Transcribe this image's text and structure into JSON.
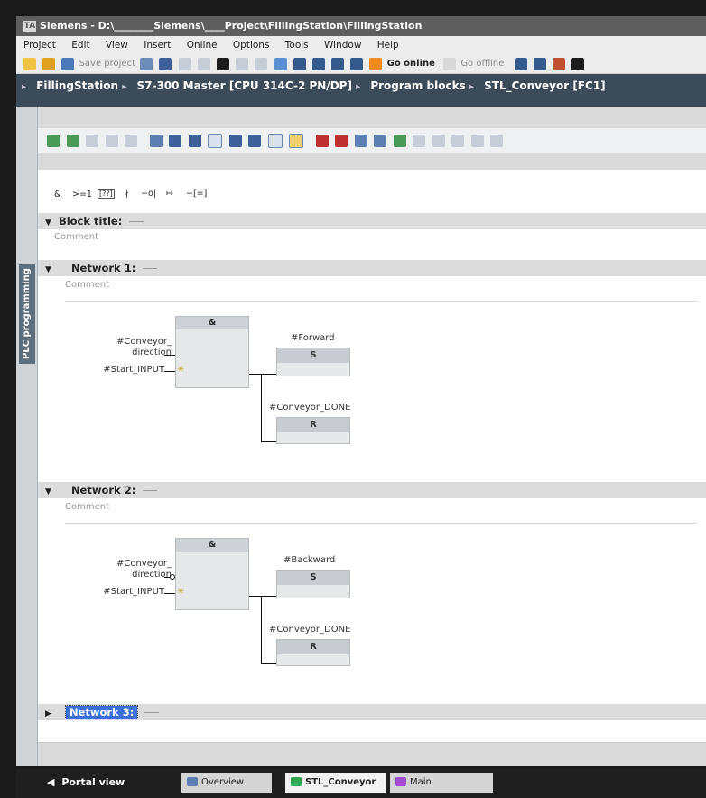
{
  "window": {
    "title": "Siemens - D:\\________Siemens\\____Project\\FillingStation\\FillingStation"
  },
  "menu": [
    "Project",
    "Edit",
    "View",
    "Insert",
    "Online",
    "Options",
    "Tools",
    "Window",
    "Help"
  ],
  "toolbar": {
    "save_label": "Save project",
    "go_online_label": "Go online",
    "go_offline_label": "Go offline"
  },
  "breadcrumb": [
    "FillingStation",
    "S7-300 Master [CPU 314C-2 PN/DP]",
    "Program blocks",
    "STL_Conveyor [FC1]"
  ],
  "side_panel": {
    "label": "PLC programming"
  },
  "lad_palette": [
    "&",
    ">=1",
    "[??]",
    "∤",
    "−o|",
    "↦",
    "−[=]"
  ],
  "block": {
    "title_label": "Block title:",
    "comment_placeholder": "Comment"
  },
  "networks": [
    {
      "label": "Network 1:",
      "comment_placeholder": "Comment",
      "and_label": "&",
      "inputs": [
        {
          "name_line1": "#Conveyor_",
          "name_line2": "direction",
          "negated": false
        },
        {
          "name_line1": "#Start_INPUT",
          "negated": false
        }
      ],
      "coils": [
        {
          "operand": "#Forward",
          "type": "S"
        },
        {
          "operand": "#Conveyor_DONE",
          "type": "R"
        }
      ]
    },
    {
      "label": "Network 2:",
      "comment_placeholder": "Comment",
      "and_label": "&",
      "inputs": [
        {
          "name_line1": "#Conveyor_",
          "name_line2": "direction",
          "negated": true
        },
        {
          "name_line1": "#Start_INPUT",
          "negated": false
        }
      ],
      "coils": [
        {
          "operand": "#Backward",
          "type": "S"
        },
        {
          "operand": "#Conveyor_DONE",
          "type": "R"
        }
      ]
    },
    {
      "label": "Network 3:"
    }
  ],
  "bottom": {
    "portal_view": "Portal view",
    "tabs": [
      "Overview",
      "STL_Conveyor",
      "Main"
    ]
  },
  "colors": {
    "breadcrumb_bg": "#3b4b59",
    "selection": "#3a6fd8",
    "stl_icon": "#2fa84f",
    "main_icon": "#a24bd1"
  }
}
